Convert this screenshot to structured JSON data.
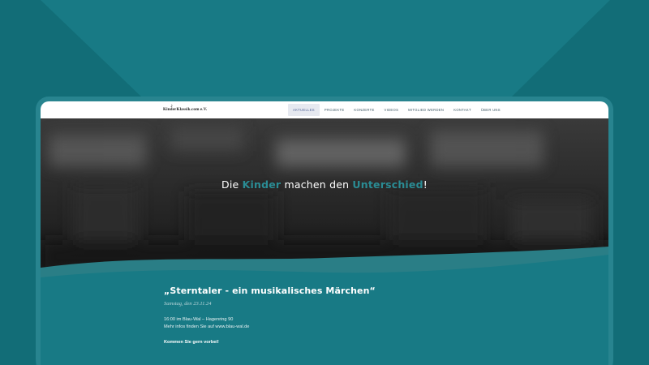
{
  "site": {
    "logo_text": "KinderKlassik.com e.V.",
    "logo_note": "♪"
  },
  "nav": {
    "items": [
      {
        "label": "Aktuelles",
        "active": true
      },
      {
        "label": "Projekte",
        "active": false
      },
      {
        "label": "Konzerte",
        "active": false
      },
      {
        "label": "Videos",
        "active": false
      },
      {
        "label": "Mitglied werden",
        "active": false
      },
      {
        "label": "Kontakt",
        "active": false
      },
      {
        "label": "Über uns",
        "active": false
      }
    ]
  },
  "hero": {
    "text_before": "Die ",
    "highlight_1": "Kinder",
    "text_middle": " machen den ",
    "highlight_2": "Unterschied",
    "text_after": "!"
  },
  "event": {
    "title": "„Sterntaler - ein musikalisches Märchen“",
    "date": "Samstag, den 23.11.24",
    "line_1": "16:00 im Blau-Wal – Hagenring 90",
    "line_2": "Mehr infos finden Sie auf www.blau-wal.de",
    "cta": "Kommen Sie gern vorbei!"
  },
  "colors": {
    "background": "#187a85",
    "accent": "#2a8c94",
    "nav_active_bg": "#e6e9f0"
  }
}
